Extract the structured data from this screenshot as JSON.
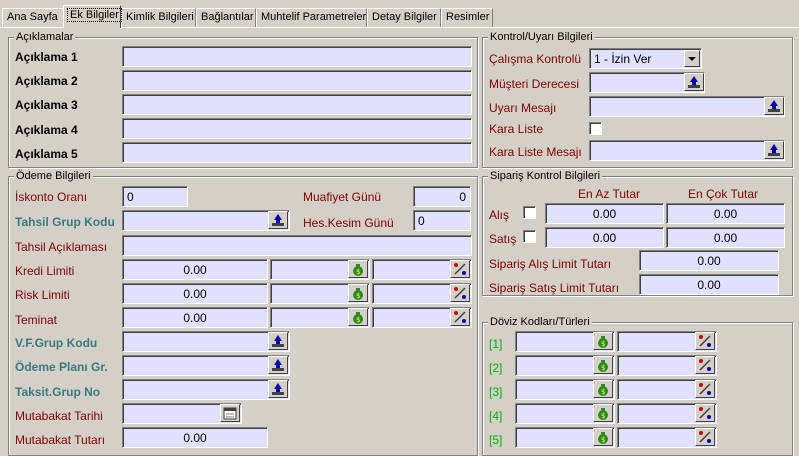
{
  "tabs": [
    "Ana Sayfa",
    "Ek Bilgiler",
    "Kimlik Bilgileri",
    "Bağlantılar",
    "Muhtelif Parametreler",
    "Detay Bilgiler",
    "Resimler"
  ],
  "aciklamalar": {
    "legend": "Açıklamalar",
    "labels": [
      "Açıklama 1",
      "Açıklama 2",
      "Açıklama 3",
      "Açıklama 4",
      "Açıklama 5"
    ]
  },
  "kontrol": {
    "legend": "Kontrol/Uyarı Bilgileri",
    "calisma_label": "Çalışma Kontrolü",
    "calisma_value": "1 - İzin Ver",
    "musteri_label": "Müşteri Derecesi",
    "uyari_label": "Uyarı Mesajı",
    "kara_liste_label": "Kara Liste",
    "kara_liste_mesaji_label": "Kara Liste Mesajı"
  },
  "odeme": {
    "legend": "Ödeme Bilgileri",
    "iskonto_label": "İskonto Oranı",
    "iskonto_value": "0",
    "muafiyet_label": "Muafiyet Günü",
    "muafiyet_value": "0",
    "tahsil_grup_label": "Tahsil Grup Kodu",
    "hes_kesim_label": "Hes.Kesim Günü",
    "hes_kesim_value": "0",
    "tahsil_aciklama_label": "Tahsil Açıklaması",
    "kredi_label": "Kredi Limiti",
    "kredi_value": "0.00",
    "risk_label": "Risk Limiti",
    "risk_value": "0.00",
    "teminat_label": "Teminat",
    "teminat_value": "0.00",
    "vf_grup_label": "V.F.Grup Kodu",
    "odeme_plani_label": "Ödeme Planı Gr.",
    "taksit_label": "Taksit.Grup No",
    "mutabakat_tarihi_label": "Mutabakat Tarihi",
    "mutabakat_tutari_label": "Mutabakat Tutarı",
    "mutabakat_tutari_value": "0.00"
  },
  "siparis": {
    "legend": "Sipariş Kontrol Bilgileri",
    "en_az_header": "En Az Tutar",
    "en_cok_header": "En Çok Tutar",
    "alis_label": "Alış",
    "alis_min": "0.00",
    "alis_max": "0.00",
    "satis_label": "Satış",
    "satis_min": "0.00",
    "satis_max": "0.00",
    "alis_limit_label": "Sipariş Alış Limit Tutarı",
    "alis_limit_value": "0.00",
    "satis_limit_label": "Sipariş Satış Limit Tutarı",
    "satis_limit_value": "0.00"
  },
  "doviz": {
    "legend": "Döviz Kodları/Türleri",
    "rows": [
      "[1]",
      "[2]",
      "[3]",
      "[4]",
      "[5]"
    ]
  },
  "colors": {
    "field_bg": "#e0e0ff",
    "teal_label": "#3a7a80",
    "maroon_label": "#800000",
    "green_label": "#00b000",
    "window_bg": "#d4d0c8"
  }
}
